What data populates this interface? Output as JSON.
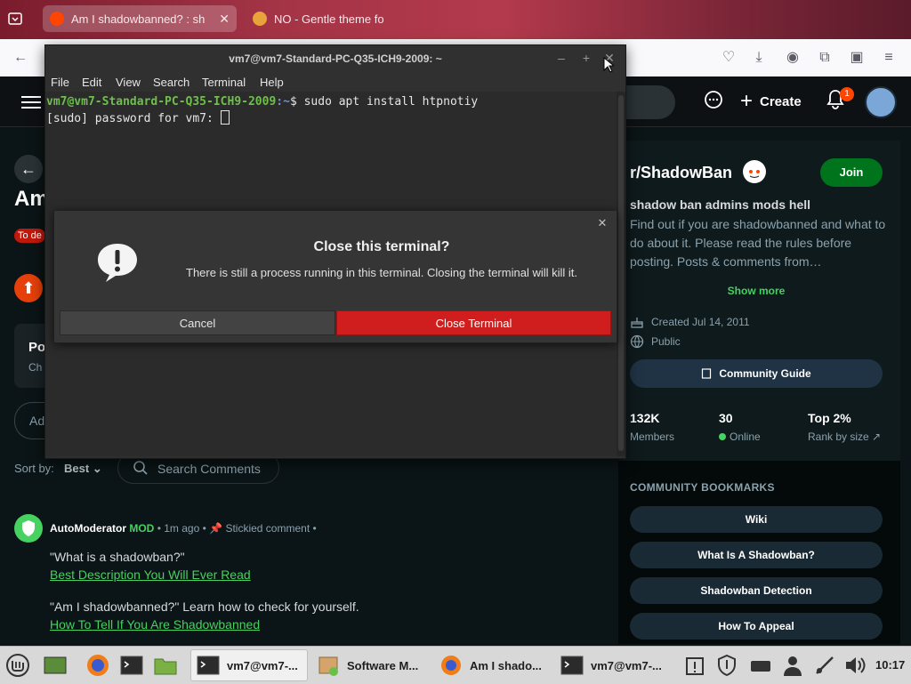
{
  "browser": {
    "tabs": [
      {
        "title": "Am I shadowbanned? : sh"
      },
      {
        "title": "NO - Gentle theme fo"
      }
    ],
    "add_tab": "+"
  },
  "reddit_header": {
    "create_label": "Create",
    "notification_count": "1"
  },
  "post": {
    "title_visible": "Am",
    "flair_visible": "To de",
    "poll_title_visible": "Po",
    "poll_sub_visible": "Ch",
    "add_comment_visible": "Ad",
    "sort_label": "Sort by:",
    "sort_value": "Best",
    "search_comments_placeholder": "Search Comments"
  },
  "comment": {
    "author": "AutoModerator",
    "mod_badge": "MOD",
    "time": "1m ago",
    "stickied": "Stickied comment",
    "line1": "\"What is a shadowban?\"",
    "link1": "Best Description You Will Ever Read",
    "line2": "\"Am I shadowbanned?\" Learn how to check for yourself.",
    "link2": "How To Tell If You Are Shadowbanned"
  },
  "sidebar": {
    "community_name": "r/ShadowBan",
    "join_label": "Join",
    "tagline": "shadow ban admins mods hell",
    "description": "Find out if you are shadowbanned and what to do about it. Please read the rules before posting. Posts & comments from…",
    "show_more": "Show more",
    "created": "Created Jul 14, 2011",
    "visibility": "Public",
    "guide_label": "Community Guide",
    "stats": [
      {
        "value": "132K",
        "label": "Members"
      },
      {
        "value": "30",
        "label": "Online"
      },
      {
        "value": "Top 2%",
        "label": "Rank by size"
      }
    ],
    "bookmarks_title": "COMMUNITY BOOKMARKS",
    "bookmarks": [
      "Wiki",
      "What Is A Shadowban?",
      "Shadowban Detection",
      "How To Appeal"
    ]
  },
  "terminal": {
    "title": "vm7@vm7-Standard-PC-Q35-ICH9-2009: ~",
    "menu": [
      "File",
      "Edit",
      "View",
      "Search",
      "Terminal",
      "Help"
    ],
    "prompt_user": "vm7@vm7-Standard-PC-Q35-ICH9-2009",
    "prompt_path": ":~",
    "command": "$ sudo apt install htpnotiy",
    "line2": "[sudo] password for vm7: "
  },
  "dialog": {
    "title": "Close this terminal?",
    "message": "There is still a process running in this terminal. Closing the terminal will kill it.",
    "cancel_label": "Cancel",
    "close_label": "Close Terminal"
  },
  "taskbar": {
    "tasks": [
      {
        "label": "vm7@vm7-..."
      },
      {
        "label": "Software M..."
      },
      {
        "label": "Am I shado..."
      },
      {
        "label": "vm7@vm7-..."
      }
    ],
    "clock": "10:17"
  },
  "colors": {
    "reddit_green": "#46d160",
    "join_green": "#00731d",
    "close_red": "#d01e1e",
    "upvote_orange": "#e5400a"
  }
}
